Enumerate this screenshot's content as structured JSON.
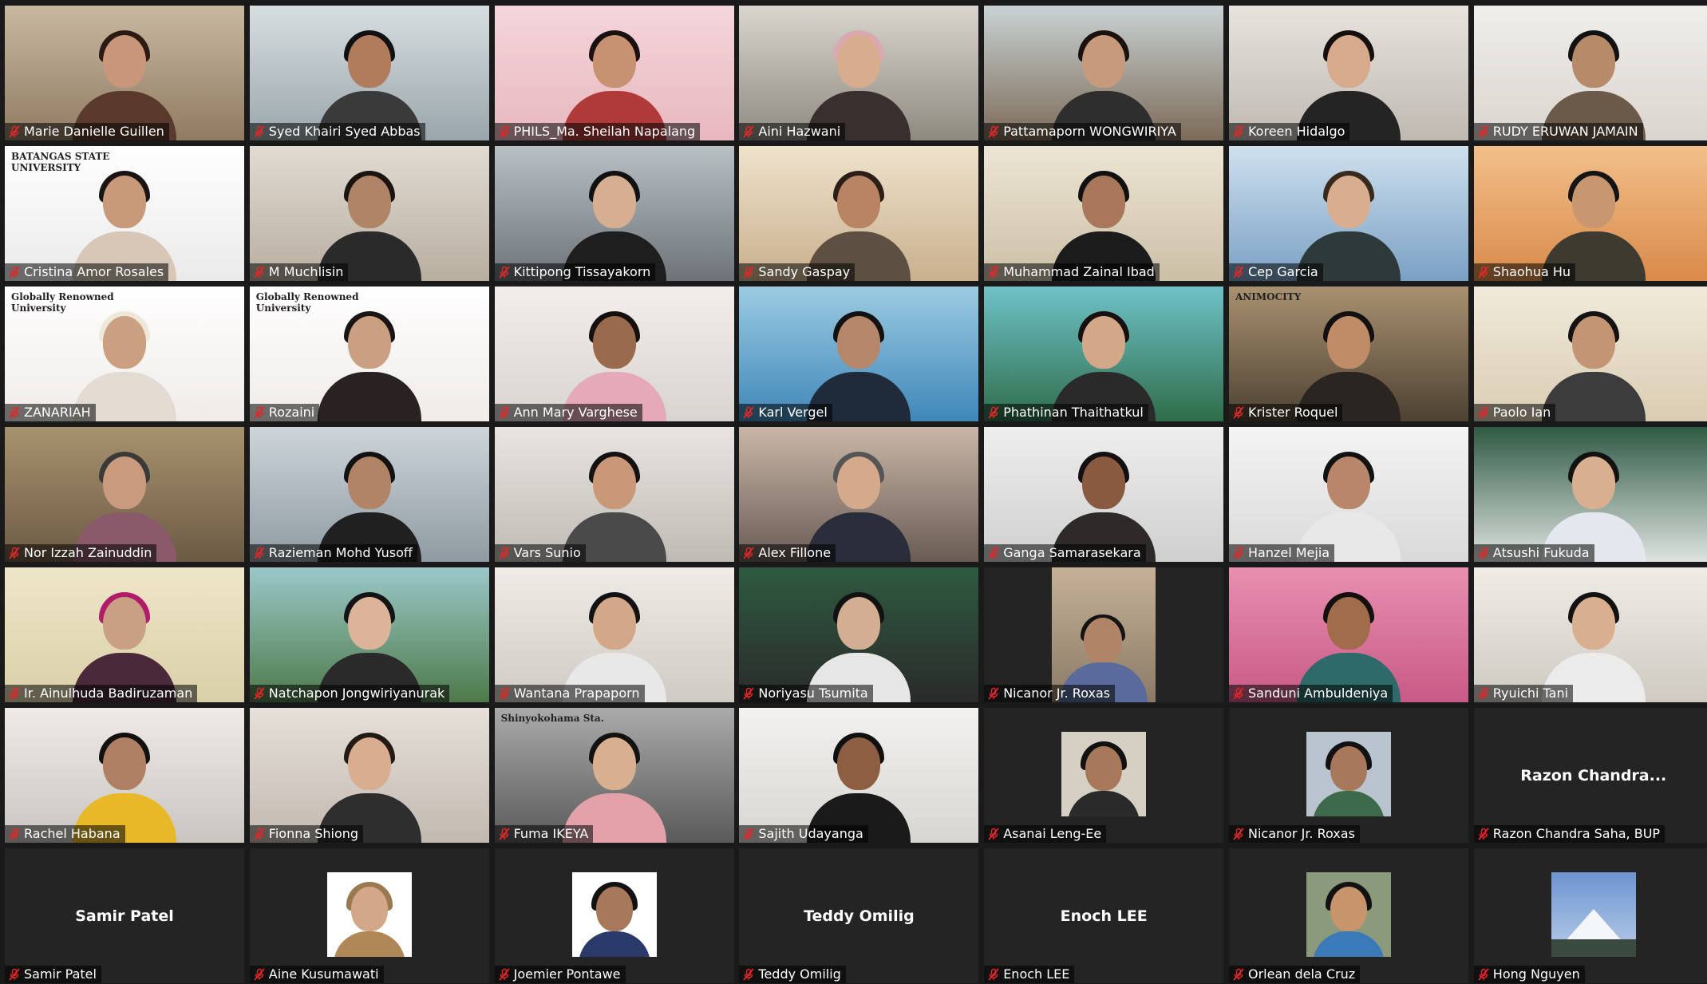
{
  "meeting": {
    "layout": "gallery-view",
    "columns": 7,
    "rows": 7
  },
  "icons": {
    "muted_mic": "mic-muted-icon",
    "muted_color": "#e02828"
  },
  "participants": [
    {
      "name": "Marie Danielle Guillen",
      "video": true,
      "bg": "#8f7b62",
      "bg2": "#c9b8a0",
      "skin": "#c8977a",
      "hair": "#2a1a12",
      "shirt": "#5b3a2e"
    },
    {
      "name": "Syed Khairi Syed Abbas",
      "video": true,
      "bg": "#9aa6ac",
      "bg2": "#d8dee0",
      "skin": "#b07c5c",
      "hair": "#111111",
      "shirt": "#3a3a3a"
    },
    {
      "name": "PHILS_Ma. Sheilah Napalang",
      "video": true,
      "bg": "#e8b7c0",
      "bg2": "#f4d6da",
      "skin": "#c79272",
      "hair": "#1a1010",
      "shirt": "#b03a3a"
    },
    {
      "name": "Aini Hazwani",
      "video": true,
      "bg": "#8e8a80",
      "bg2": "#d9d6cf",
      "skin": "#d7ad8e",
      "hair": "#d9a8b0",
      "shirt": "#3a2f2f"
    },
    {
      "name": "Pattamaporn WONGWIRIYA",
      "video": true,
      "bg": "#7c6b58",
      "bg2": "#c9d2d4",
      "skin": "#c89a7c",
      "hair": "#1b1210",
      "shirt": "#2e2e2e"
    },
    {
      "name": "Koreen Hidalgo",
      "video": true,
      "bg": "#bfb9b2",
      "bg2": "#e7e3de",
      "skin": "#d8aa8c",
      "hair": "#15100e",
      "shirt": "#242424"
    },
    {
      "name": "RUDY ERUWAN JAMAIN",
      "video": true,
      "bg": "#d9d5cf",
      "bg2": "#f0eeea",
      "skin": "#b78a6a",
      "hair": "#121212",
      "shirt": "#6b5a4a"
    },
    {
      "name": "Cristina Amor Rosales",
      "video": true,
      "bg": "#eaeaea",
      "bg2": "#ffffff",
      "skin": "#c99a7a",
      "hair": "#1a1414",
      "shirt": "#d8c7b6",
      "overlay": "BATANGAS STATE UNIVERSITY"
    },
    {
      "name": "M Muchlisin",
      "video": true,
      "bg": "#b8aea0",
      "bg2": "#e1dbd2",
      "skin": "#b08466",
      "hair": "#1c1410",
      "shirt": "#2a2a2a"
    },
    {
      "name": "Kittipong Tissayakorn",
      "video": true,
      "bg": "#6d7378",
      "bg2": "#b9c0c4",
      "skin": "#d6ae92",
      "hair": "#111111",
      "shirt": "#1e1e1e"
    },
    {
      "name": "Sandy Gaspay",
      "video": true,
      "bg": "#c9b08e",
      "bg2": "#efe2cc",
      "skin": "#b98463",
      "hair": "#2c1f18",
      "shirt": "#5d5042"
    },
    {
      "name": "Muhammad Zainal Ibad",
      "video": true,
      "bg": "#cbbfa6",
      "bg2": "#ede5d4",
      "skin": "#a9785a",
      "hair": "#101010",
      "shirt": "#1c1c1c"
    },
    {
      "name": "Cep Garcia",
      "video": true,
      "bg": "#7aa0c4",
      "bg2": "#cfe0ee",
      "skin": "#d9ad90",
      "hair": "#3a2a1e",
      "shirt": "#2e3a3a"
    },
    {
      "name": "Shaohua Hu",
      "video": true,
      "bg": "#d98a4a",
      "bg2": "#f2c08a",
      "skin": "#c9976f",
      "hair": "#141414",
      "shirt": "#3e3a30"
    },
    {
      "name": "ZANARIAH",
      "video": true,
      "bg": "#efebe8",
      "bg2": "#ffffff",
      "skin": "#caa080",
      "hair": "#efe7da",
      "shirt": "#e3dbd1",
      "overlay": "Globally Renowned University"
    },
    {
      "name": "Rozaini",
      "video": true,
      "bg": "#efebe8",
      "bg2": "#ffffff",
      "skin": "#caa080",
      "hair": "#1a1414",
      "shirt": "#2a2222",
      "overlay": "Globally Renowned University"
    },
    {
      "name": "Ann Mary Varghese",
      "video": true,
      "bg": "#d8d4cf",
      "bg2": "#f2efeb",
      "skin": "#9a6a4c",
      "hair": "#151010",
      "shirt": "#e5a9b8"
    },
    {
      "name": "Karl Vergel",
      "video": true,
      "bg": "#3f87b8",
      "bg2": "#9ccbe3",
      "skin": "#b58667",
      "hair": "#121212",
      "shirt": "#1f2a3a"
    },
    {
      "name": "Phathinan Thaithatkul",
      "video": true,
      "bg": "#2f6d4a",
      "bg2": "#6fc2c8",
      "skin": "#d3a888",
      "hair": "#161010",
      "shirt": "#2a2a2a"
    },
    {
      "name": "Krister Roquel",
      "video": true,
      "bg": "#4e4233",
      "bg2": "#a89170",
      "skin": "#c08c68",
      "hair": "#121010",
      "shirt": "#2a2520",
      "overlay": "ANIMOCITY"
    },
    {
      "name": "Paolo Ian",
      "video": true,
      "bg": "#d9ccb2",
      "bg2": "#f1eadb",
      "skin": "#c49575",
      "hair": "#141212",
      "shirt": "#3c3c3c"
    },
    {
      "name": "Nor Izzah Zainuddin",
      "video": true,
      "bg": "#6c5a44",
      "bg2": "#a8936f",
      "skin": "#c99a7e",
      "hair": "#3a3a3a",
      "shirt": "#8a5a6a"
    },
    {
      "name": "Razieman Mohd Yusoff",
      "video": true,
      "bg": "#8f9aa2",
      "bg2": "#cdd5da",
      "skin": "#b28466",
      "hair": "#121212",
      "shirt": "#202020"
    },
    {
      "name": "Vars Sunio",
      "video": true,
      "bg": "#bfbab4",
      "bg2": "#e8e5e1",
      "skin": "#c89878",
      "hair": "#121212",
      "shirt": "#4a4a4a"
    },
    {
      "name": "Alex Fillone",
      "video": true,
      "bg": "#6a5c54",
      "bg2": "#c9b6a8",
      "skin": "#d4a98c",
      "hair": "#555555",
      "shirt": "#2a2e3a"
    },
    {
      "name": "Ganga Samarasekara",
      "video": true,
      "bg": "#cfcfcf",
      "bg2": "#eeeeee",
      "skin": "#8a5a40",
      "hair": "#121010",
      "shirt": "#2e2a2a"
    },
    {
      "name": "Hanzel Mejia",
      "video": true,
      "bg": "#d9d9d9",
      "bg2": "#f4f4f4",
      "skin": "#b8876a",
      "hair": "#121212",
      "shirt": "#e8e8e8"
    },
    {
      "name": "Atsushi Fukuda",
      "video": true,
      "bg": "#dfe3e0",
      "bg2": "#2f5a44",
      "skin": "#d8b090",
      "hair": "#121212",
      "shirt": "#e4e8ee"
    },
    {
      "name": "Ir. Ainulhuda Badiruzaman",
      "video": true,
      "bg": "#d9cfa8",
      "bg2": "#eee6c8",
      "skin": "#caa084",
      "hair": "#b01c6a",
      "shirt": "#4a2a3a"
    },
    {
      "name": "Natchapon Jongwiriyanurak",
      "video": true,
      "bg": "#4e7a4a",
      "bg2": "#9ac8c8",
      "skin": "#dcb49a",
      "hair": "#141414",
      "shirt": "#2a2a2a"
    },
    {
      "name": "Wantana Prapaporn",
      "video": true,
      "bg": "#cfcac4",
      "bg2": "#efebe6",
      "skin": "#d2a888",
      "hair": "#121212",
      "shirt": "#e8e8e8"
    },
    {
      "name": "Noriyasu Tsumita",
      "video": true,
      "bg": "#2a2a2a",
      "bg2": "#2e5a40",
      "skin": "#d4ae92",
      "hair": "#121212",
      "shirt": "#e6e6e6"
    },
    {
      "name": "Nicanor Jr. Roxas",
      "video": true,
      "bg": "#242424",
      "bg2": "#c6b198",
      "skin": "#b08466",
      "hair": "#141414",
      "shirt": "#5a6a9a",
      "inset": true
    },
    {
      "name": "Sanduni Ambuldeniya",
      "video": true,
      "bg": "#c85a86",
      "bg2": "#e88fb0",
      "skin": "#a06c4c",
      "hair": "#121010",
      "shirt": "#2f6a6a"
    },
    {
      "name": "Ryuichi Tani",
      "video": true,
      "bg": "#cfcac2",
      "bg2": "#efece6",
      "skin": "#d8b090",
      "hair": "#121212",
      "shirt": "#ebebeb"
    },
    {
      "name": "Rachel Habana",
      "video": true,
      "bg": "#c9c5c0",
      "bg2": "#eeebe7",
      "skin": "#b08064",
      "hair": "#121010",
      "shirt": "#e8b828"
    },
    {
      "name": "Fionna Shiong",
      "video": true,
      "bg": "#c2b9b0",
      "bg2": "#e6e0da",
      "skin": "#d8ad90",
      "hair": "#241a14",
      "shirt": "#2e2e2e"
    },
    {
      "name": "Fuma IKEYA",
      "video": true,
      "bg": "#5a5a5a",
      "bg2": "#aaaaaa",
      "skin": "#d8b090",
      "hair": "#121212",
      "shirt": "#e2a2a8",
      "overlay": "Shinyokohama Sta."
    },
    {
      "name": "Sajith Udayanga",
      "video": true,
      "bg": "#d8d6d2",
      "bg2": "#f2f1ef",
      "skin": "#8e5e42",
      "hair": "#101010",
      "shirt": "#1a1a1a"
    },
    {
      "name": "Asanai Leng-Ee",
      "video": false,
      "photo": true,
      "bg": "#242424",
      "skin": "#a8785a",
      "hair": "#121212",
      "shirt": "#2a2a2a",
      "photo_bg": "#d6cfc4"
    },
    {
      "name": "Nicanor Jr. Roxas",
      "video": false,
      "photo": true,
      "bg": "#242424",
      "skin": "#a8785a",
      "hair": "#121212",
      "shirt": "#3c6a4a",
      "photo_bg": "#b9c4cf"
    },
    {
      "name": "Razon Chandra Saha, BUP",
      "video": false,
      "center_label": "Razon  Chandra...",
      "bg": "#242424"
    },
    {
      "name": "Samir Patel",
      "video": false,
      "center_label": "Samir Patel",
      "bg": "#242424"
    },
    {
      "name": "Aine Kusumawati",
      "video": false,
      "photo": true,
      "bg": "#242424",
      "skin": "#d2a888",
      "hair": "#9a7850",
      "shirt": "#b08858",
      "photo_bg": "#ffffff"
    },
    {
      "name": "Joemier Pontawe",
      "video": false,
      "photo": true,
      "bg": "#242424",
      "skin": "#a8785a",
      "hair": "#121212",
      "shirt": "#2a3a6a",
      "photo_bg": "#ffffff"
    },
    {
      "name": "Teddy Omilig",
      "video": false,
      "center_label": "Teddy Omilig",
      "bg": "#242424"
    },
    {
      "name": "Enoch LEE",
      "video": false,
      "center_label": "Enoch LEE",
      "bg": "#242424"
    },
    {
      "name": "Orlean dela Cruz",
      "video": false,
      "photo": true,
      "bg": "#242424",
      "skin": "#c8946c",
      "hair": "#121212",
      "shirt": "#3a7ab8",
      "photo_bg": "#8a9a7a"
    },
    {
      "name": "Hong Nguyen",
      "video": false,
      "photo": true,
      "landscape": true,
      "bg": "#242424",
      "photo_bg": "#6d94d0"
    }
  ]
}
